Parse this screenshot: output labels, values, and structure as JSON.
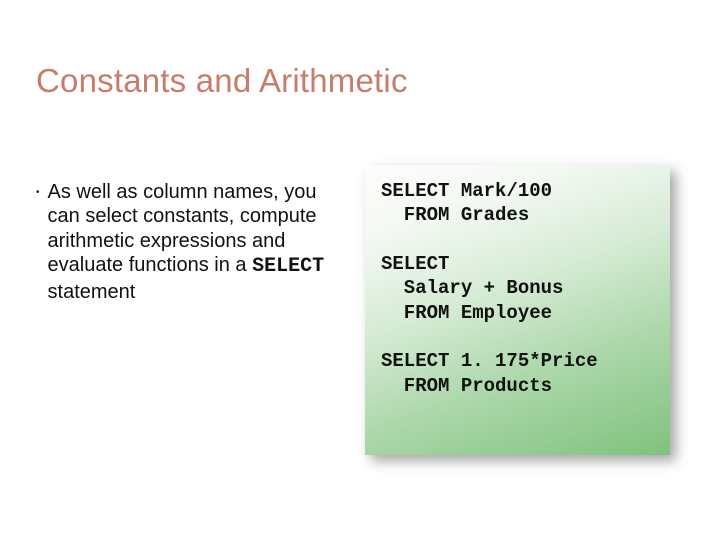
{
  "title": "Constants and Arithmetic",
  "bullet": {
    "lead": "As well as column names, you can select constants, compute arithmetic expressions  and evaluate functions in a ",
    "kw": "SELECT",
    "tail": " statement"
  },
  "code": "SELECT Mark/100\n  FROM Grades\n\nSELECT\n  Salary + Bonus\n  FROM Employee\n\nSELECT 1. 175*Price\n  FROM Products"
}
